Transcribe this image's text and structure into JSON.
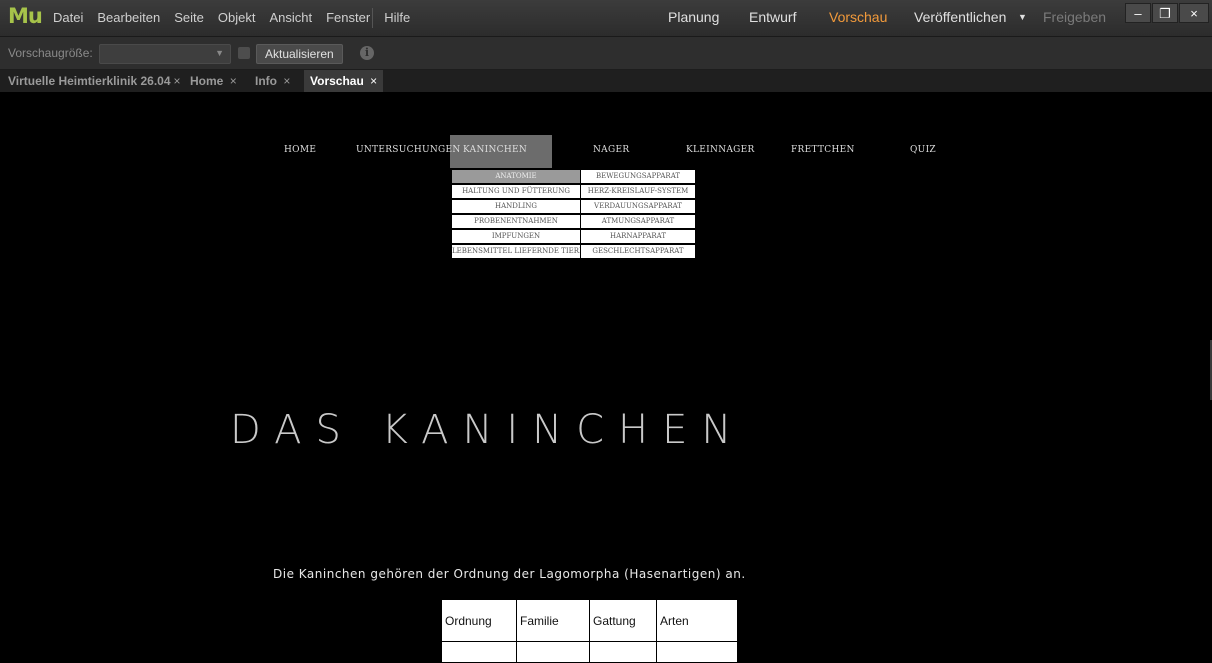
{
  "app": {
    "logo": "Mu",
    "menu": [
      "Datei",
      "Bearbeiten",
      "Seite",
      "Objekt",
      "Ansicht",
      "Fenster",
      "Hilfe"
    ],
    "modes": {
      "planung": "Planung",
      "entwurf": "Entwurf",
      "vorschau": "Vorschau",
      "veroeffentlichen": "Veröffentlichen",
      "freigeben": "Freigeben"
    },
    "window_controls": {
      "minimize": "–",
      "restore": "❐",
      "close": "×"
    }
  },
  "toolbar": {
    "preview_size_label": "Vorschaugröße:",
    "preview_size_value": "",
    "refresh_label": "Aktualisieren",
    "info_glyph": "i"
  },
  "tabs": [
    {
      "label": "Virtuelle Heimtierklinik 26.04",
      "close": "×"
    },
    {
      "label": "Home",
      "close": "×"
    },
    {
      "label": "Info",
      "close": "×"
    },
    {
      "label": "Vorschau",
      "close": "×"
    }
  ],
  "site": {
    "nav": [
      "Home",
      "Untersuchungen",
      "Kaninchen",
      "Nager",
      "Kleinnager",
      "Frettchen",
      "Quiz"
    ],
    "nav_active": "Kaninchen",
    "dropdown_left": [
      "Anatomie",
      "Haltung und Fütterung",
      "Handling",
      "Probenentnahmen",
      "Impfungen",
      "Lebensmittel liefernde Tiere"
    ],
    "dropdown_right": [
      "Bewegungsapparat",
      "Herz-Kreislauf-System",
      "Verdauungsapparat",
      "Atmungsapparat",
      "Harnapparat",
      "Geschlechtsapparat"
    ],
    "dropdown_highlight": "Anatomie",
    "hero_title": "DAS KANINCHEN",
    "intro": "Die Kaninchen gehören der Ordnung der Lagomorpha (Hasenartigen) an.",
    "table_headers": [
      "Ordnung",
      "Familie",
      "Gattung",
      "Arten"
    ]
  },
  "colors": {
    "accent_orange": "#f29a3b",
    "logo_green": "#a6c34a",
    "nav_active_bg": "#6c6c6c",
    "dropdown_highlight_bg": "#9a9a9a"
  }
}
